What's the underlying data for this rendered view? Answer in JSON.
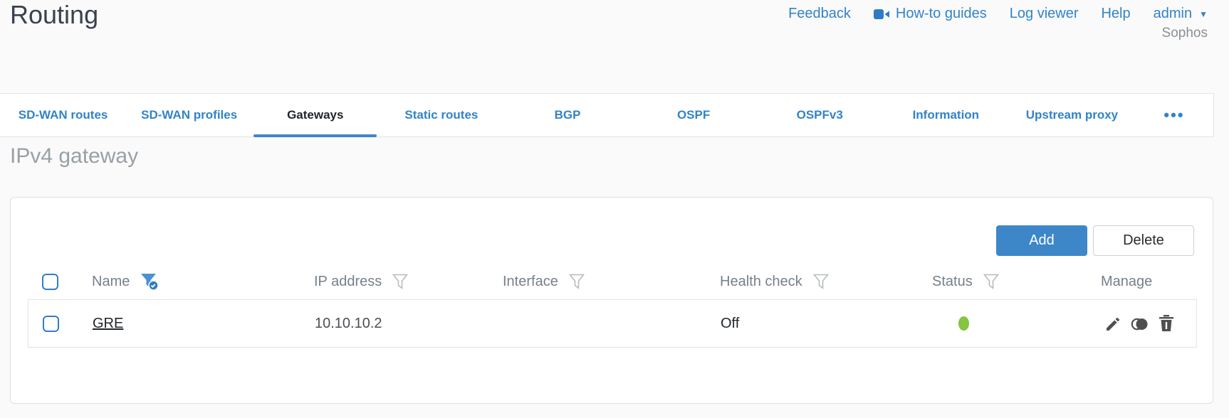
{
  "page": {
    "title": "Routing",
    "brand": "Sophos"
  },
  "header_links": {
    "feedback": "Feedback",
    "howto": "How-to guides",
    "logviewer": "Log viewer",
    "help": "Help",
    "user": "admin"
  },
  "tabs": {
    "items": [
      {
        "label": "SD-WAN routes",
        "active": false
      },
      {
        "label": "SD-WAN profiles",
        "active": false
      },
      {
        "label": "Gateways",
        "active": true
      },
      {
        "label": "Static routes",
        "active": false
      },
      {
        "label": "BGP",
        "active": false
      },
      {
        "label": "OSPF",
        "active": false
      },
      {
        "label": "OSPFv3",
        "active": false
      },
      {
        "label": "Information",
        "active": false
      },
      {
        "label": "Upstream proxy",
        "active": false
      }
    ],
    "more_label": "•••"
  },
  "section": {
    "heading": "IPv4 gateway"
  },
  "toolbar": {
    "add_label": "Add",
    "delete_label": "Delete"
  },
  "table": {
    "columns": [
      {
        "label": "Name",
        "filter": "active"
      },
      {
        "label": "IP address",
        "filter": "inactive"
      },
      {
        "label": "Interface",
        "filter": "inactive"
      },
      {
        "label": "Health check",
        "filter": "inactive"
      },
      {
        "label": "Status",
        "filter": "inactive"
      },
      {
        "label": "Manage",
        "filter": "none"
      }
    ],
    "rows": [
      {
        "name": "GRE",
        "ip_address": "10.10.10.2",
        "interface": "",
        "health_check": "Off",
        "status": "up",
        "status_color": "#84c441",
        "manage_icons": [
          "edit-icon",
          "clone-icon",
          "delete-icon"
        ]
      }
    ]
  },
  "colors": {
    "accent_blue": "#3183c8",
    "button_blue": "#3d87c9",
    "status_green": "#84c441",
    "title_dark": "#39424e",
    "heading_gray": "#98a0a6"
  }
}
